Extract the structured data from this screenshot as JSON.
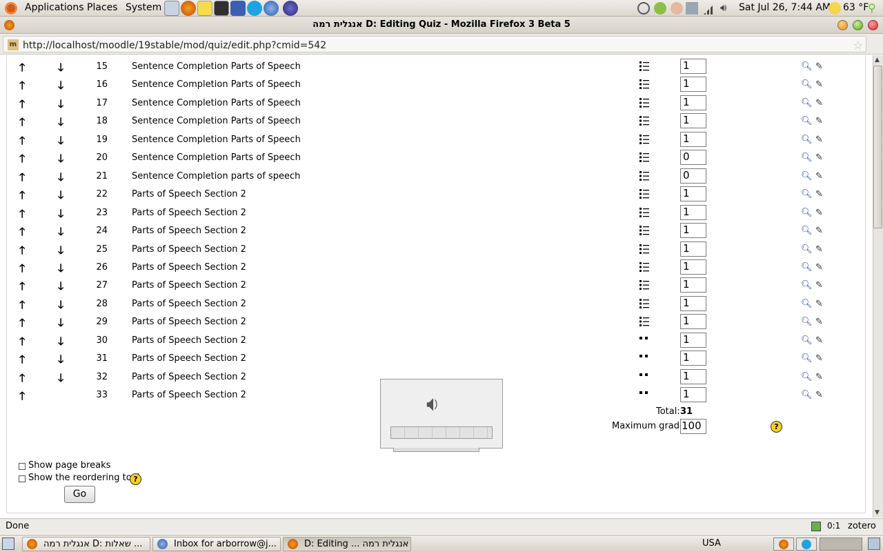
{
  "panel": {
    "menus": [
      "Applications",
      "Places",
      "System"
    ],
    "clock": "Sat Jul 26,  7:44 AM",
    "weather": "63 °F"
  },
  "window": {
    "title": "אנגלית רמה D: Editing Quiz - Mozilla Firefox 3 Beta 5"
  },
  "address_bar": {
    "url": "http://localhost/moodle/19stable/mod/quiz/edit.php?cmid=542"
  },
  "questions": [
    {
      "num": "15",
      "name": "Sentence Completion Parts of Speech",
      "type": "multichoice",
      "grade": "1",
      "down": true
    },
    {
      "num": "16",
      "name": "Sentence Completion Parts of Speech",
      "type": "multichoice",
      "grade": "1",
      "down": true
    },
    {
      "num": "17",
      "name": "Sentence Completion Parts of Speech",
      "type": "multichoice",
      "grade": "1",
      "down": true
    },
    {
      "num": "18",
      "name": "Sentence Completion Parts of Speech",
      "type": "multichoice",
      "grade": "1",
      "down": true
    },
    {
      "num": "19",
      "name": "Sentence Completion Parts of Speech",
      "type": "multichoice",
      "grade": "1",
      "down": true
    },
    {
      "num": "20",
      "name": "Sentence Completion Parts of Speech",
      "type": "multichoice",
      "grade": "0",
      "down": true
    },
    {
      "num": "21",
      "name": "Sentence Completion parts of speech",
      "type": "multichoice",
      "grade": "0",
      "down": true
    },
    {
      "num": "22",
      "name": "Parts of Speech Section 2",
      "type": "multichoice",
      "grade": "1",
      "down": true
    },
    {
      "num": "23",
      "name": "Parts of Speech Section 2",
      "type": "multichoice",
      "grade": "1",
      "down": true
    },
    {
      "num": "24",
      "name": "Parts of Speech Section 2",
      "type": "multichoice",
      "grade": "1",
      "down": true
    },
    {
      "num": "25",
      "name": "Parts of Speech Section 2",
      "type": "multichoice",
      "grade": "1",
      "down": true
    },
    {
      "num": "26",
      "name": "Parts of Speech Section 2",
      "type": "multichoice",
      "grade": "1",
      "down": true
    },
    {
      "num": "27",
      "name": "Parts of Speech Section 2",
      "type": "multichoice",
      "grade": "1",
      "down": true
    },
    {
      "num": "28",
      "name": "Parts of Speech Section 2",
      "type": "multichoice",
      "grade": "1",
      "down": true
    },
    {
      "num": "29",
      "name": "Parts of Speech Section 2",
      "type": "multichoice",
      "grade": "1",
      "down": true
    },
    {
      "num": "30",
      "name": "Parts of Speech Section 2",
      "type": "match",
      "grade": "1",
      "down": true
    },
    {
      "num": "31",
      "name": "Parts of Speech Section 2",
      "type": "match",
      "grade": "1",
      "down": true
    },
    {
      "num": "32",
      "name": "Parts of Speech Section 2",
      "type": "match",
      "grade": "1",
      "down": true
    },
    {
      "num": "33",
      "name": "Parts of Speech Section 2",
      "type": "match",
      "grade": "1",
      "down": false
    }
  ],
  "summary": {
    "total_label": "Total:",
    "total_value": "31",
    "max_grade_label": "Maximum grade:",
    "max_grade_value": "100"
  },
  "options": {
    "show_page_breaks": "Show page breaks",
    "show_reordering_tool": "Show the reordering tool",
    "go": "Go"
  },
  "status": {
    "text": "Done",
    "count": "0:1",
    "zotero": "zotero"
  },
  "taskbar": {
    "tasks": [
      "אנגלית רמה D: שאלות ...",
      "Inbox for arborrow@j...",
      "D: Editing ... אנגלית רמה"
    ],
    "keyboard": "USA"
  },
  "colors": {
    "accent_blue": "#203c8c",
    "help_yellow": "#f5d21e"
  }
}
